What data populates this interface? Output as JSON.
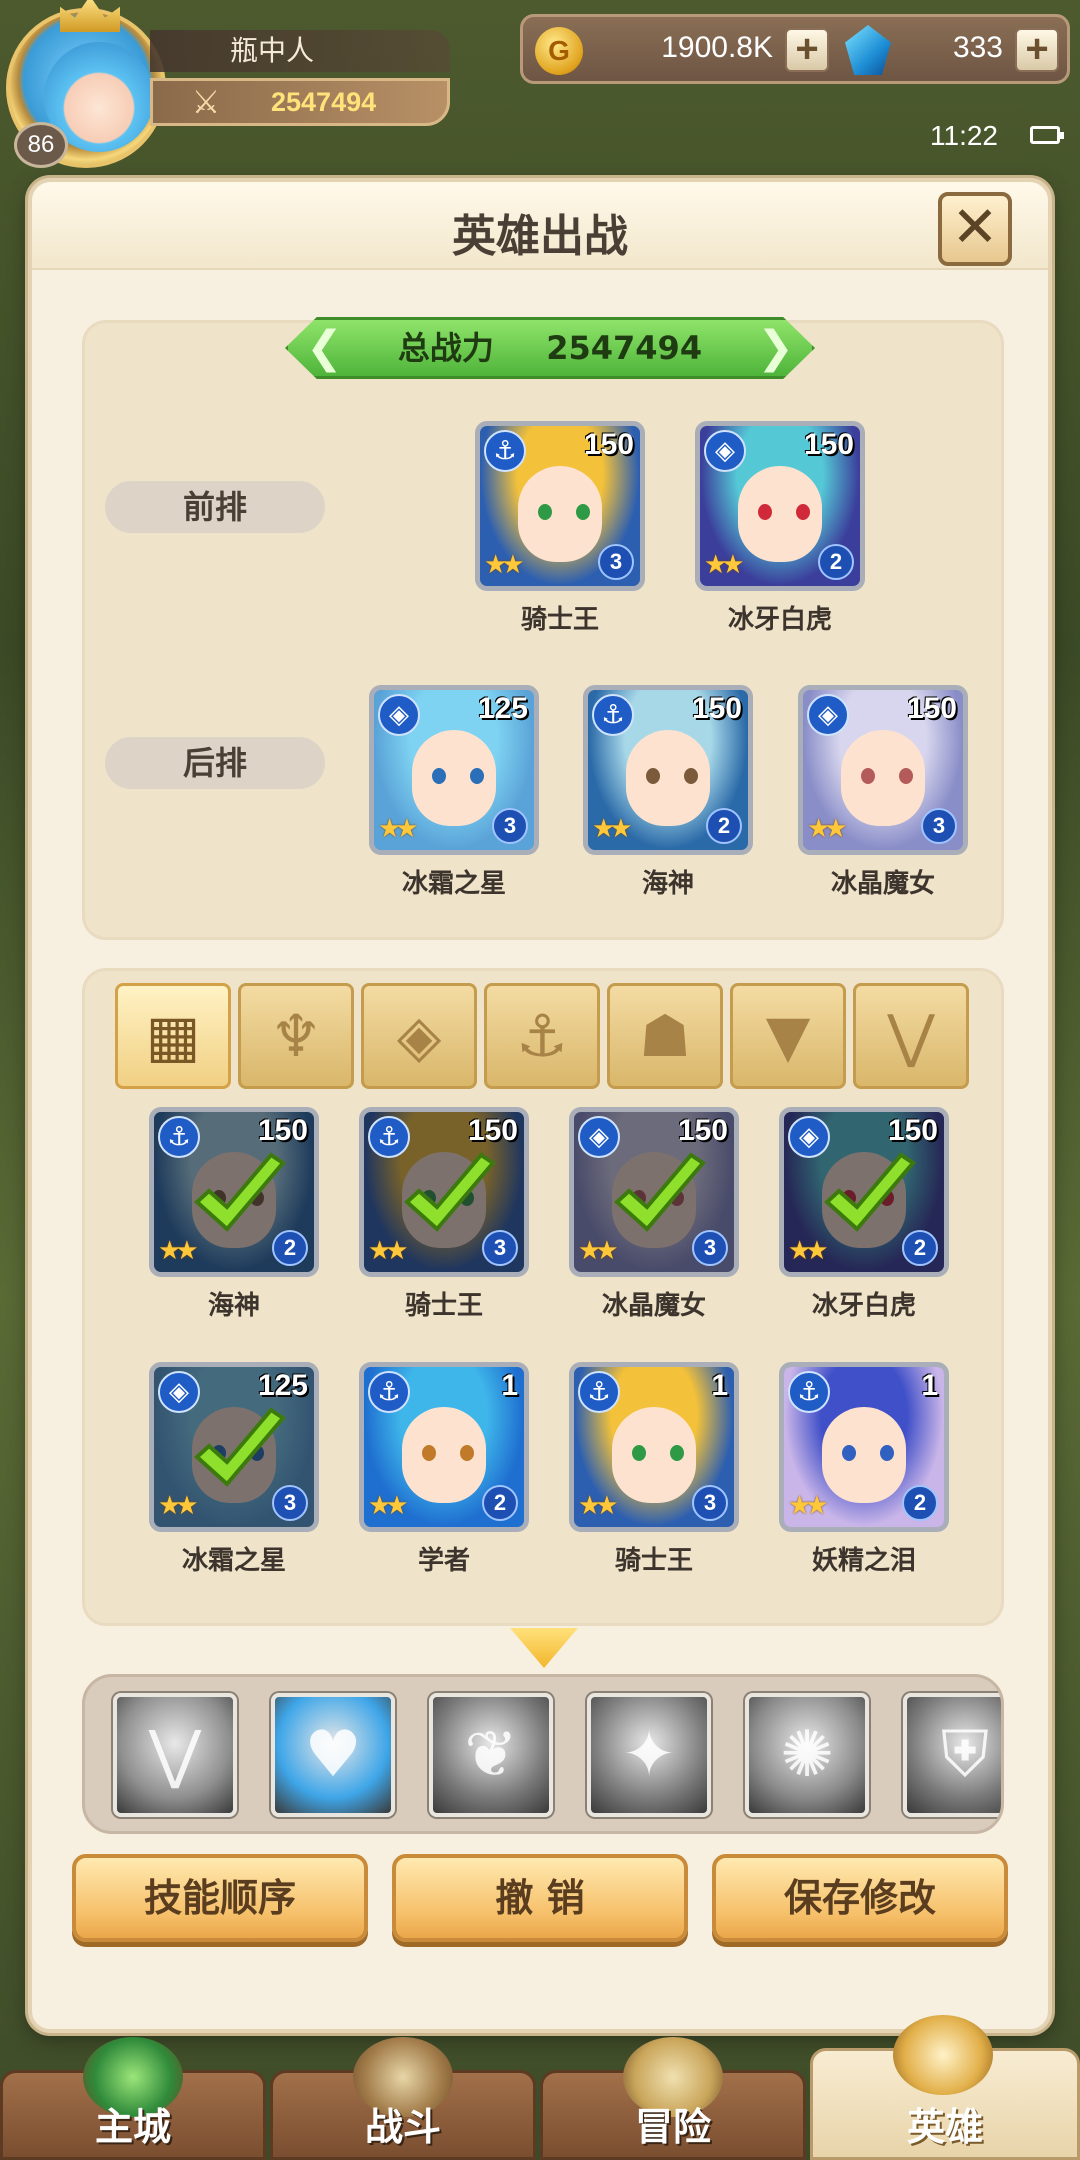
{
  "player": {
    "name": "瓶中人",
    "power": "2547494",
    "level": "86"
  },
  "currency": {
    "gold": "1900.8K",
    "gems": "333"
  },
  "status": {
    "time": "11:22"
  },
  "panel": {
    "title": "英雄出战",
    "total_power_label": "总战力",
    "total_power_value": "2547494"
  },
  "formation": {
    "front_label": "前排",
    "back_label": "后排",
    "front": [
      {
        "name": "骑士王",
        "level": "150",
        "stars": "3",
        "class_icon": "anchor-icon",
        "hair": "#f3c13a",
        "bg": "#2d5fb0",
        "eyes": "#2f9a45"
      },
      {
        "name": "冰牙白虎",
        "level": "150",
        "stars": "2",
        "class_icon": "shield-icon",
        "hair": "#55c8d6",
        "bg": "#3b3f9b",
        "eyes": "#d02a3a"
      }
    ],
    "back": [
      {
        "name": "冰霜之星",
        "level": "125",
        "stars": "3",
        "class_icon": "shield-icon",
        "hair": "#7fd3f2",
        "bg": "#5aa3d8",
        "eyes": "#2a6fb8"
      },
      {
        "name": "海神",
        "level": "150",
        "stars": "2",
        "class_icon": "anchor-icon",
        "hair": "#a7d8e8",
        "bg": "#2b6aa8",
        "eyes": "#7a5a3a"
      },
      {
        "name": "冰晶魔女",
        "level": "150",
        "stars": "3",
        "class_icon": "shield-icon",
        "hair": "#d8d6ee",
        "bg": "#8a8ec8",
        "eyes": "#b45a5a"
      }
    ]
  },
  "roster": {
    "filters": [
      {
        "name": "filter-all",
        "glyph": "▦"
      },
      {
        "name": "filter-class-1",
        "glyph": "♆"
      },
      {
        "name": "filter-class-2",
        "glyph": "◈"
      },
      {
        "name": "filter-class-3",
        "glyph": "⚓"
      },
      {
        "name": "filter-class-4",
        "glyph": "☗"
      },
      {
        "name": "filter-class-5",
        "glyph": "▼"
      },
      {
        "name": "filter-class-6",
        "glyph": "⋁"
      }
    ],
    "heroes": [
      {
        "name": "海神",
        "level": "150",
        "stars": "2",
        "class_icon": "anchor-icon",
        "selected": true,
        "hair": "#a7d8e8",
        "bg": "#2b6aa8",
        "eyes": "#7a5a3a"
      },
      {
        "name": "骑士王",
        "level": "150",
        "stars": "3",
        "class_icon": "anchor-icon",
        "selected": true,
        "hair": "#f3c13a",
        "bg": "#2d5fb0",
        "eyes": "#2f9a45"
      },
      {
        "name": "冰晶魔女",
        "level": "150",
        "stars": "3",
        "class_icon": "shield-icon",
        "selected": true,
        "hair": "#d8d6ee",
        "bg": "#8a8ec8",
        "eyes": "#b45a5a"
      },
      {
        "name": "冰牙白虎",
        "level": "150",
        "stars": "2",
        "class_icon": "shield-icon",
        "selected": true,
        "hair": "#55c8d6",
        "bg": "#3b3f9b",
        "eyes": "#d02a3a"
      },
      {
        "name": "冰霜之星",
        "level": "125",
        "stars": "3",
        "class_icon": "shield-icon",
        "selected": true,
        "hair": "#7fd3f2",
        "bg": "#5aa3d8",
        "eyes": "#2a6fb8"
      },
      {
        "name": "学者",
        "level": "1",
        "stars": "2",
        "class_icon": "anchor-icon",
        "selected": false,
        "hair": "#3fb6ea",
        "bg": "#1f6fd0",
        "eyes": "#c07a2a"
      },
      {
        "name": "骑士王",
        "level": "1",
        "stars": "3",
        "class_icon": "anchor-icon",
        "selected": false,
        "hair": "#f3c13a",
        "bg": "#2d5fb0",
        "eyes": "#2f9a45"
      },
      {
        "name": "妖精之泪",
        "level": "1",
        "stars": "2",
        "class_icon": "anchor-icon",
        "selected": false,
        "hair": "#4050c8",
        "bg": "#c9b5e8",
        "eyes": "#3060c0"
      }
    ]
  },
  "skills": [
    {
      "name": "skill-v-emblem",
      "glyph": "⋁",
      "color": "#8f8f8f"
    },
    {
      "name": "skill-ice-heart",
      "glyph": "♥",
      "color": "#3fa6e8"
    },
    {
      "name": "skill-flame-antler",
      "glyph": "❦",
      "color": "#7a7a7a"
    },
    {
      "name": "skill-winged-blade",
      "glyph": "✦",
      "color": "#7d7d7d"
    },
    {
      "name": "skill-vortex",
      "glyph": "✺",
      "color": "#8a8a8a"
    },
    {
      "name": "skill-shield",
      "glyph": "⛨",
      "color": "#7a7a7a"
    }
  ],
  "actions": {
    "skill_order": "技能顺序",
    "undo": "撤 销",
    "save": "保存修改"
  },
  "nav": {
    "main_city": "主城",
    "battle": "战斗",
    "adventure": "冒险",
    "heroes": "英雄"
  }
}
